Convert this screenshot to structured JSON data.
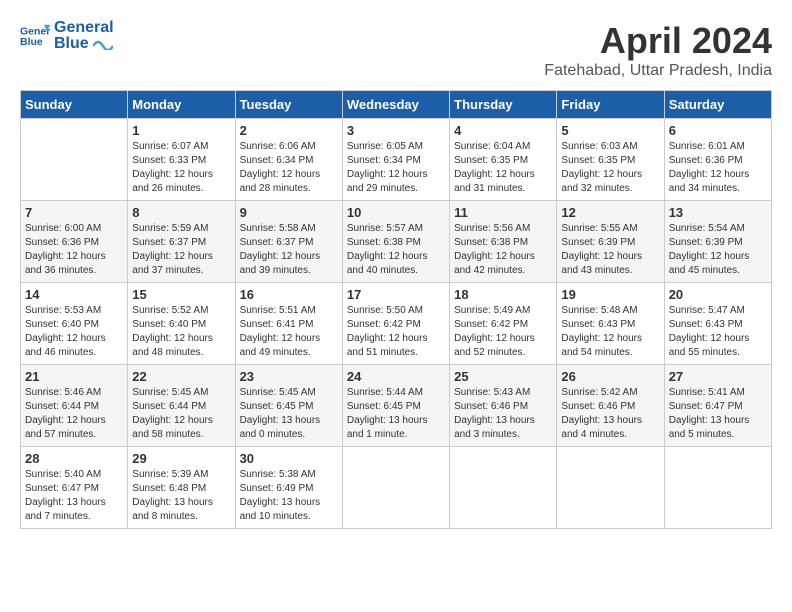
{
  "header": {
    "logo_line1": "General",
    "logo_line2": "Blue",
    "month": "April 2024",
    "location": "Fatehabad, Uttar Pradesh, India"
  },
  "days_of_week": [
    "Sunday",
    "Monday",
    "Tuesday",
    "Wednesday",
    "Thursday",
    "Friday",
    "Saturday"
  ],
  "weeks": [
    [
      {
        "day": "",
        "info": ""
      },
      {
        "day": "1",
        "info": "Sunrise: 6:07 AM\nSunset: 6:33 PM\nDaylight: 12 hours\nand 26 minutes."
      },
      {
        "day": "2",
        "info": "Sunrise: 6:06 AM\nSunset: 6:34 PM\nDaylight: 12 hours\nand 28 minutes."
      },
      {
        "day": "3",
        "info": "Sunrise: 6:05 AM\nSunset: 6:34 PM\nDaylight: 12 hours\nand 29 minutes."
      },
      {
        "day": "4",
        "info": "Sunrise: 6:04 AM\nSunset: 6:35 PM\nDaylight: 12 hours\nand 31 minutes."
      },
      {
        "day": "5",
        "info": "Sunrise: 6:03 AM\nSunset: 6:35 PM\nDaylight: 12 hours\nand 32 minutes."
      },
      {
        "day": "6",
        "info": "Sunrise: 6:01 AM\nSunset: 6:36 PM\nDaylight: 12 hours\nand 34 minutes."
      }
    ],
    [
      {
        "day": "7",
        "info": "Sunrise: 6:00 AM\nSunset: 6:36 PM\nDaylight: 12 hours\nand 36 minutes."
      },
      {
        "day": "8",
        "info": "Sunrise: 5:59 AM\nSunset: 6:37 PM\nDaylight: 12 hours\nand 37 minutes."
      },
      {
        "day": "9",
        "info": "Sunrise: 5:58 AM\nSunset: 6:37 PM\nDaylight: 12 hours\nand 39 minutes."
      },
      {
        "day": "10",
        "info": "Sunrise: 5:57 AM\nSunset: 6:38 PM\nDaylight: 12 hours\nand 40 minutes."
      },
      {
        "day": "11",
        "info": "Sunrise: 5:56 AM\nSunset: 6:38 PM\nDaylight: 12 hours\nand 42 minutes."
      },
      {
        "day": "12",
        "info": "Sunrise: 5:55 AM\nSunset: 6:39 PM\nDaylight: 12 hours\nand 43 minutes."
      },
      {
        "day": "13",
        "info": "Sunrise: 5:54 AM\nSunset: 6:39 PM\nDaylight: 12 hours\nand 45 minutes."
      }
    ],
    [
      {
        "day": "14",
        "info": "Sunrise: 5:53 AM\nSunset: 6:40 PM\nDaylight: 12 hours\nand 46 minutes."
      },
      {
        "day": "15",
        "info": "Sunrise: 5:52 AM\nSunset: 6:40 PM\nDaylight: 12 hours\nand 48 minutes."
      },
      {
        "day": "16",
        "info": "Sunrise: 5:51 AM\nSunset: 6:41 PM\nDaylight: 12 hours\nand 49 minutes."
      },
      {
        "day": "17",
        "info": "Sunrise: 5:50 AM\nSunset: 6:42 PM\nDaylight: 12 hours\nand 51 minutes."
      },
      {
        "day": "18",
        "info": "Sunrise: 5:49 AM\nSunset: 6:42 PM\nDaylight: 12 hours\nand 52 minutes."
      },
      {
        "day": "19",
        "info": "Sunrise: 5:48 AM\nSunset: 6:43 PM\nDaylight: 12 hours\nand 54 minutes."
      },
      {
        "day": "20",
        "info": "Sunrise: 5:47 AM\nSunset: 6:43 PM\nDaylight: 12 hours\nand 55 minutes."
      }
    ],
    [
      {
        "day": "21",
        "info": "Sunrise: 5:46 AM\nSunset: 6:44 PM\nDaylight: 12 hours\nand 57 minutes."
      },
      {
        "day": "22",
        "info": "Sunrise: 5:45 AM\nSunset: 6:44 PM\nDaylight: 12 hours\nand 58 minutes."
      },
      {
        "day": "23",
        "info": "Sunrise: 5:45 AM\nSunset: 6:45 PM\nDaylight: 13 hours\nand 0 minutes."
      },
      {
        "day": "24",
        "info": "Sunrise: 5:44 AM\nSunset: 6:45 PM\nDaylight: 13 hours\nand 1 minute."
      },
      {
        "day": "25",
        "info": "Sunrise: 5:43 AM\nSunset: 6:46 PM\nDaylight: 13 hours\nand 3 minutes."
      },
      {
        "day": "26",
        "info": "Sunrise: 5:42 AM\nSunset: 6:46 PM\nDaylight: 13 hours\nand 4 minutes."
      },
      {
        "day": "27",
        "info": "Sunrise: 5:41 AM\nSunset: 6:47 PM\nDaylight: 13 hours\nand 5 minutes."
      }
    ],
    [
      {
        "day": "28",
        "info": "Sunrise: 5:40 AM\nSunset: 6:47 PM\nDaylight: 13 hours\nand 7 minutes."
      },
      {
        "day": "29",
        "info": "Sunrise: 5:39 AM\nSunset: 6:48 PM\nDaylight: 13 hours\nand 8 minutes."
      },
      {
        "day": "30",
        "info": "Sunrise: 5:38 AM\nSunset: 6:49 PM\nDaylight: 13 hours\nand 10 minutes."
      },
      {
        "day": "",
        "info": ""
      },
      {
        "day": "",
        "info": ""
      },
      {
        "day": "",
        "info": ""
      },
      {
        "day": "",
        "info": ""
      }
    ]
  ]
}
